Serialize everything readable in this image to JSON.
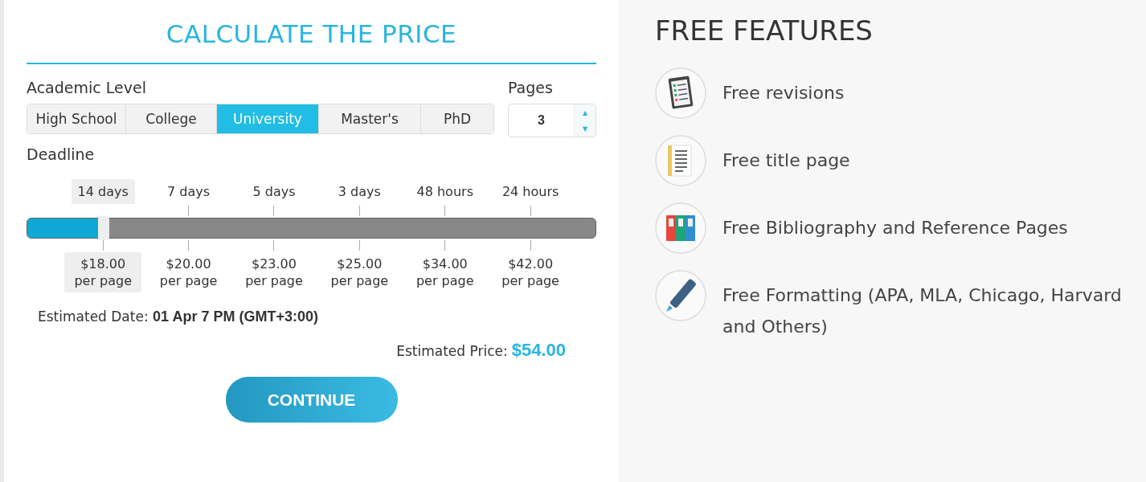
{
  "calculator": {
    "title": "CALCULATE THE PRICE",
    "academic_level": {
      "label": "Academic Level",
      "options": [
        {
          "label": "High School",
          "selected": false
        },
        {
          "label": "College",
          "selected": false
        },
        {
          "label": "University",
          "selected": true
        },
        {
          "label": "Master's",
          "selected": false
        },
        {
          "label": "PhD",
          "selected": false
        }
      ]
    },
    "pages": {
      "label": "Pages",
      "value": "3",
      "up": "▲",
      "down": "▼"
    },
    "deadline": {
      "label": "Deadline",
      "level": 0.134,
      "options": [
        {
          "label": "14 days",
          "price": "$18.00",
          "unit": "per page",
          "selected": true
        },
        {
          "label": "7 days",
          "price": "$20.00",
          "unit": "per page",
          "selected": false
        },
        {
          "label": "5 days",
          "price": "$23.00",
          "unit": "per page",
          "selected": false
        },
        {
          "label": "3 days",
          "price": "$25.00",
          "unit": "per page",
          "selected": false
        },
        {
          "label": "48 hours",
          "price": "$34.00",
          "unit": "per page",
          "selected": false
        },
        {
          "label": "24 hours",
          "price": "$42.00",
          "unit": "per page",
          "selected": false
        }
      ]
    },
    "estimated_date": {
      "label": "Estimated Date:",
      "value": "01 Apr 7 PM (GMT+3:00)"
    },
    "estimated_price": {
      "label": "Estimated Price:",
      "value": "$54.00"
    },
    "button": "CONTINUE"
  },
  "features": {
    "title": "FREE FEATURES",
    "items": [
      {
        "kind": "clipboard",
        "text": "Free revisions"
      },
      {
        "kind": "document",
        "text": "Free title page"
      },
      {
        "kind": "binders",
        "text": "Free Bibliography and Reference Pages"
      },
      {
        "kind": "marker",
        "text": "Free Formatting (APA, MLA, Chicago, Harvard and Others)"
      }
    ]
  }
}
